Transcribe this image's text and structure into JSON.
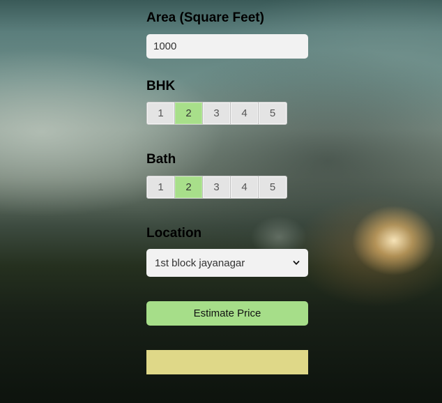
{
  "area": {
    "label": "Area (Square Feet)",
    "value": "1000"
  },
  "bhk": {
    "label": "BHK",
    "options": [
      "1",
      "2",
      "3",
      "4",
      "5"
    ],
    "selected": "2"
  },
  "bath": {
    "label": "Bath",
    "options": [
      "1",
      "2",
      "3",
      "4",
      "5"
    ],
    "selected": "2"
  },
  "location": {
    "label": "Location",
    "selected": "1st block jayanagar",
    "icon": "chevron-down-icon"
  },
  "estimate_button": {
    "label": "Estimate Price"
  },
  "result": {
    "text": ""
  },
  "colors": {
    "selected_option": "#a8df8a",
    "primary_button": "#a6de89",
    "result_box": "#dfd888",
    "field_background": "#f2f2f2"
  }
}
